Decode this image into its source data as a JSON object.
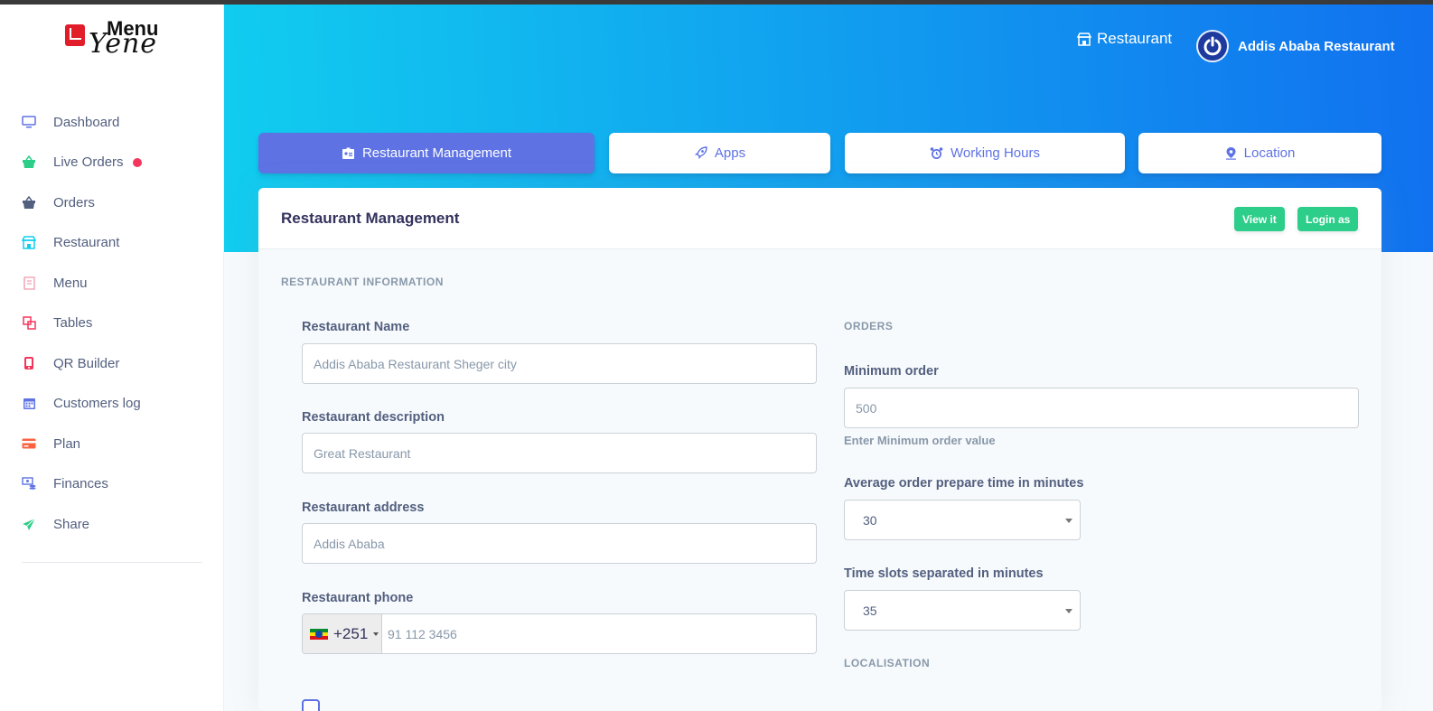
{
  "brand": {
    "logo_text_top": "Menu",
    "logo_text_bottom": "Yene"
  },
  "sidebar": {
    "items": [
      {
        "label": "Dashboard",
        "icon": "monitor-icon",
        "color": "#5e72e4"
      },
      {
        "label": "Live Orders",
        "icon": "basket-icon",
        "color": "#2dce89",
        "badge": true
      },
      {
        "label": "Orders",
        "icon": "basket-icon",
        "color": "#525f7f"
      },
      {
        "label": "Restaurant",
        "icon": "shop-icon",
        "color": "#11cdef"
      },
      {
        "label": "Menu",
        "icon": "book-icon",
        "color": "#f3a4b5"
      },
      {
        "label": "Tables",
        "icon": "tables-icon",
        "color": "#f5365c"
      },
      {
        "label": "QR Builder",
        "icon": "mobile-icon",
        "color": "#f5365c"
      },
      {
        "label": "Customers log",
        "icon": "calendar-icon",
        "color": "#5e72e4"
      },
      {
        "label": "Plan",
        "icon": "credit-card-icon",
        "color": "#fb6340"
      },
      {
        "label": "Finances",
        "icon": "money-icon",
        "color": "#5e72e4"
      },
      {
        "label": "Share",
        "icon": "send-icon",
        "color": "#2dce89"
      }
    ]
  },
  "header": {
    "restaurant_link": "Restaurant",
    "user_name": "Addis Ababa Restaurant"
  },
  "tabs": [
    {
      "label": "Restaurant Management",
      "icon": "badge-icon",
      "active": true
    },
    {
      "label": "Apps",
      "icon": "rocket-icon",
      "active": false
    },
    {
      "label": "Working Hours",
      "icon": "alarm-clock-icon",
      "active": false
    },
    {
      "label": "Location",
      "icon": "map-pin-icon",
      "active": false
    }
  ],
  "card": {
    "title": "Restaurant Management",
    "view_button": "View it",
    "login_button": "Login as",
    "section_info": "RESTAURANT INFORMATION",
    "fields": {
      "name_label": "Restaurant Name",
      "name_value": "Addis Ababa Restaurant Sheger city",
      "description_label": "Restaurant description",
      "description_value": "Great Restaurant",
      "address_label": "Restaurant address",
      "address_value": "Addis Ababa",
      "phone_label": "Restaurant phone",
      "phone_code": "+251",
      "phone_placeholder": "91 112 3456"
    },
    "orders": {
      "heading": "ORDERS",
      "min_label": "Minimum order",
      "min_value": "500",
      "min_help": "Enter Minimum order value",
      "prep_label": "Average order prepare time in minutes",
      "prep_value": "30",
      "slots_label": "Time slots separated in minutes",
      "slots_value": "35"
    },
    "localisation_heading": "LOCALISATION"
  },
  "colors": {
    "primary": "#5e72e4",
    "success": "#2dce89",
    "header_gradient_start": "#11cdef",
    "header_gradient_end": "#1171ef"
  }
}
